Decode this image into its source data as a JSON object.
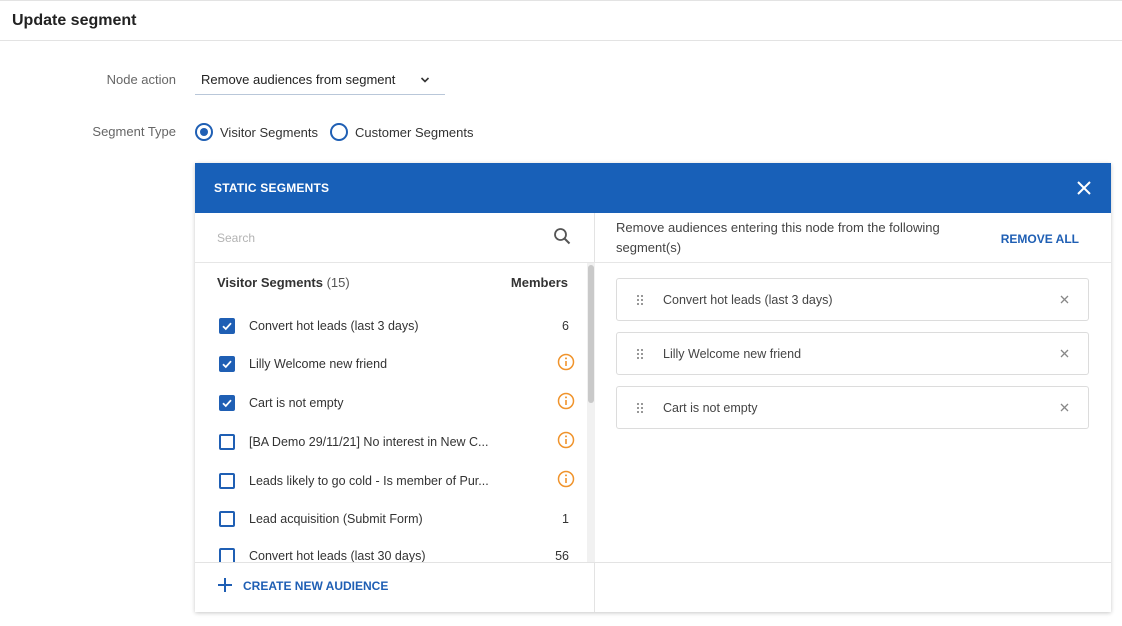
{
  "page": {
    "title": "Update segment"
  },
  "form": {
    "node_action_label": "Node action",
    "node_action_value": "Remove audiences from segment",
    "segment_type_label": "Segment Type",
    "segment_types": [
      {
        "label": "Visitor Segments",
        "selected": true
      },
      {
        "label": "Customer Segments",
        "selected": false
      }
    ]
  },
  "panel": {
    "title": "STATIC SEGMENTS",
    "search_placeholder": "Search",
    "list_title": "Visitor Segments",
    "list_count": "(15)",
    "members_header": "Members",
    "rows": [
      {
        "label": "Convert hot leads (last 3 days)",
        "checked": true,
        "members": "6",
        "icon": null
      },
      {
        "label": "Lilly Welcome new friend",
        "checked": true,
        "members": null,
        "icon": "info-icon"
      },
      {
        "label": "Cart is not empty",
        "checked": true,
        "members": null,
        "icon": "info-icon"
      },
      {
        "label": "[BA Demo 29/11/21] No interest in New C...",
        "checked": false,
        "members": null,
        "icon": "info-icon"
      },
      {
        "label": "Leads likely to go cold - Is member of Pur...",
        "checked": false,
        "members": null,
        "icon": "info-icon"
      },
      {
        "label": "Lead acquisition (Submit Form)",
        "checked": false,
        "members": "1",
        "icon": null
      },
      {
        "label": "Convert hot leads (last 30 days)",
        "checked": false,
        "members": "56",
        "icon": null
      }
    ],
    "create_label": "CREATE NEW AUDIENCE",
    "right_description": "Remove audiences entering this node from the following segment(s)",
    "remove_all_label": "REMOVE ALL",
    "selected": [
      {
        "label": "Convert hot leads (last 3 days)"
      },
      {
        "label": "Lilly Welcome new friend"
      },
      {
        "label": "Cart is not empty"
      }
    ]
  },
  "colors": {
    "accent": "#1f5fb4",
    "header_bg": "#1860b8",
    "info": "#f0932b"
  }
}
